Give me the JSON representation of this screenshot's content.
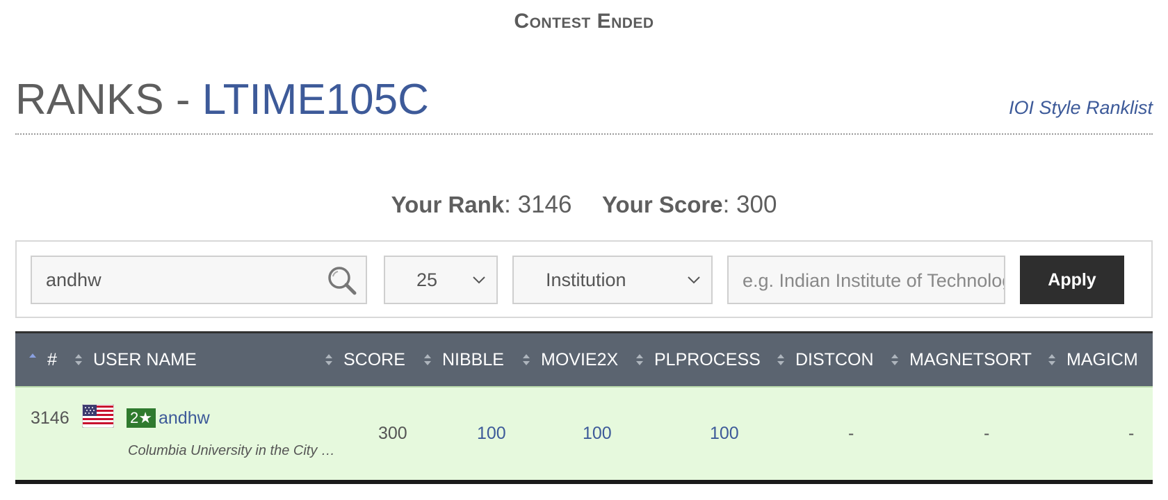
{
  "contest_status": "Contest Ended",
  "header": {
    "title_prefix": "RANKS - ",
    "contest_code": "LTIME105C",
    "ioi_link": "IOI Style Ranklist"
  },
  "your_stats": {
    "rank_label": "Your Rank",
    "rank_value": "3146",
    "score_label": "Your Score",
    "score_value": "300",
    "separator": ": "
  },
  "filters": {
    "search_value": "andhw",
    "page_size": "25",
    "filter_type": "Institution",
    "institution_placeholder": "e.g. Indian Institute of Technology",
    "apply_label": "Apply"
  },
  "table": {
    "columns": [
      "#",
      "USER NAME",
      "SCORE",
      "NIBBLE",
      "MOVIE2X",
      "PLPROCESS",
      "DISTCON",
      "MAGNETSORT",
      "MAGICM"
    ],
    "rows": [
      {
        "rank": "3146",
        "country_flag": "usa-flag",
        "stars": "2★",
        "username": "andhw",
        "institution": "Columbia University in the City …",
        "score": "300",
        "nibble": "100",
        "movie2x": "100",
        "plprocess": "100",
        "distcon": "-",
        "magnetsort": "-",
        "magicm": "-"
      }
    ]
  },
  "colors": {
    "accent_blue": "#3d5a99",
    "header_bg": "#5b6470",
    "row_bg": "#e6f9dd",
    "apply_bg": "#2e2e2e",
    "star_badge": "#2f7a2e"
  }
}
